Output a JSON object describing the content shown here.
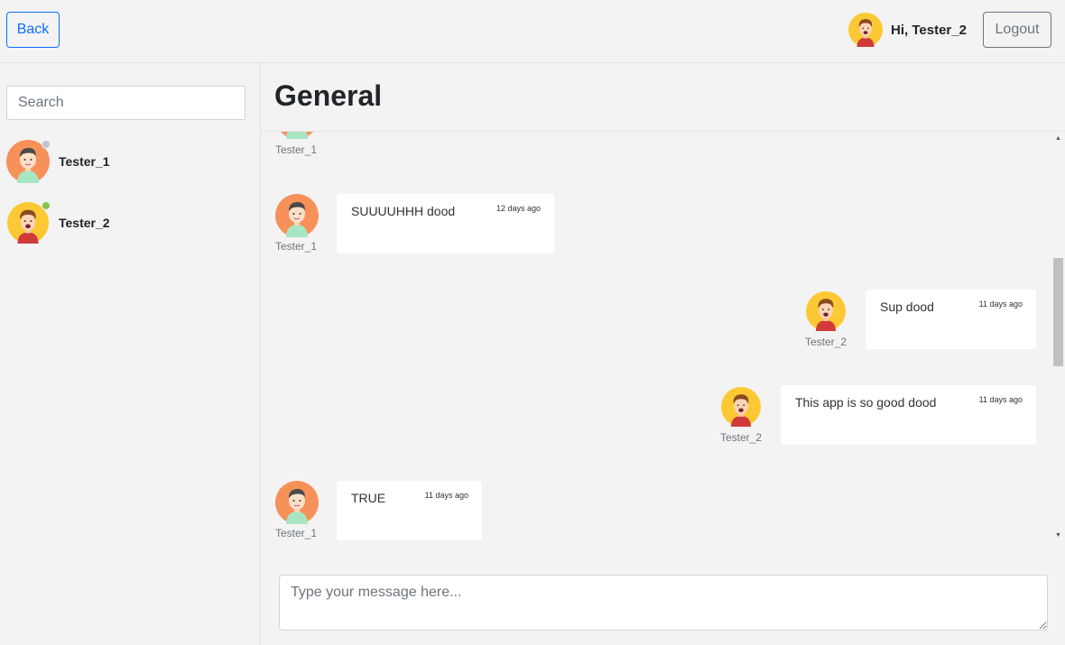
{
  "header": {
    "back_label": "Back",
    "greeting": "Hi, Tester_2",
    "logout_label": "Logout"
  },
  "sidebar": {
    "search_placeholder": "Search",
    "users": [
      {
        "name": "Tester_1",
        "avatar": "avatar-boy-orange",
        "status_color": "#b9c3d4"
      },
      {
        "name": "Tester_2",
        "avatar": "avatar-boy-yellow",
        "status_color": "#8bc34a"
      }
    ]
  },
  "chat": {
    "title": "General",
    "messages": [
      {
        "sender": "Tester_1",
        "text": "",
        "time": "",
        "side": "left"
      },
      {
        "sender": "Tester_1",
        "text": "SUUUUHHH dood",
        "time": "12 days ago",
        "side": "left"
      },
      {
        "sender": "Tester_2",
        "text": "Sup dood",
        "time": "11 days ago",
        "side": "right"
      },
      {
        "sender": "Tester_2",
        "text": "This app is so good dood",
        "time": "11 days ago",
        "side": "right"
      },
      {
        "sender": "Tester_1",
        "text": "TRUE",
        "time": "11 days ago",
        "side": "left"
      }
    ],
    "composer_placeholder": "Type your message here..."
  },
  "colors": {
    "primary": "#0d6efd",
    "secondary": "#6c757d",
    "background": "#f3f3f3"
  }
}
